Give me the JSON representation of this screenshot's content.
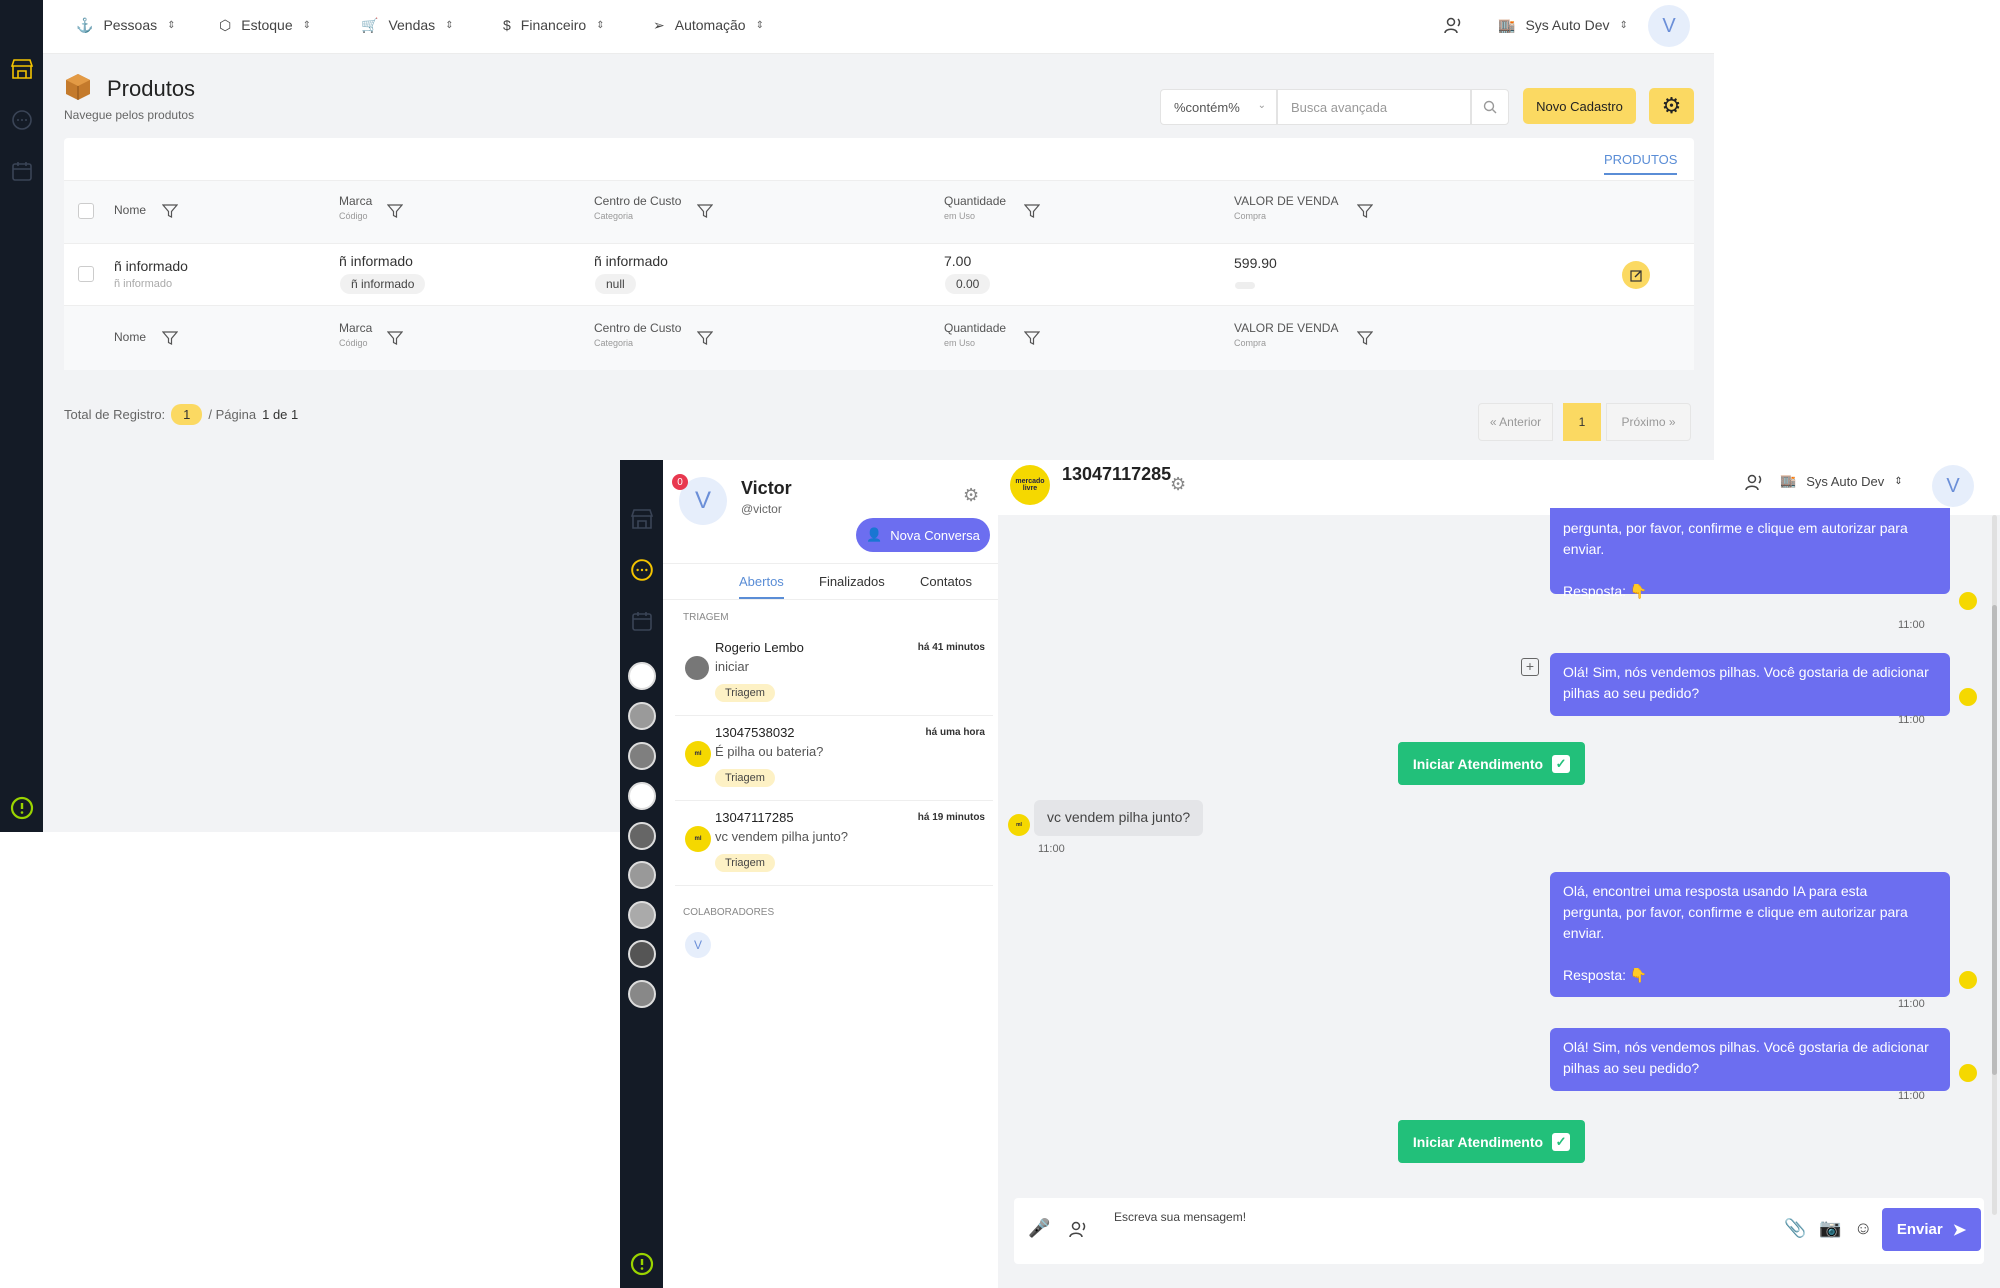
{
  "products_window": {
    "nav": {
      "items": [
        {
          "label": "Pessoas"
        },
        {
          "label": "Estoque"
        },
        {
          "label": "Vendas"
        },
        {
          "label": "Financeiro"
        },
        {
          "label": "Automação"
        }
      ],
      "company": "Sys Auto Dev",
      "avatar_initial": "V"
    },
    "page": {
      "title": "Produtos",
      "subtitle": "Navegue pelos produtos"
    },
    "search": {
      "operator": "%contém%",
      "placeholder": "Busca avançada",
      "new_button": "Novo Cadastro"
    },
    "tab": "PRODUTOS",
    "table": {
      "columns": [
        {
          "label": "Nome",
          "sub": ""
        },
        {
          "label": "Marca",
          "sub": "Código"
        },
        {
          "label": "Centro de Custo",
          "sub": "Categoria"
        },
        {
          "label": "Quantidade",
          "sub": "em Uso"
        },
        {
          "label": "VALOR DE VENDA",
          "sub": "Compra"
        }
      ],
      "rows": [
        {
          "nome": "ñ informado",
          "nome_sub": "ñ informado",
          "marca": "ñ informado",
          "codigo": "ñ informado",
          "centro": "ñ informado",
          "categoria": "null",
          "quantidade": "7.00",
          "em_uso": "0.00",
          "valor": "599.90"
        }
      ]
    },
    "footer": {
      "total_label": "Total de Registro:",
      "total_value": "1",
      "page_label": "/ Página",
      "page_value": "1 de 1",
      "prev": "« Anterior",
      "current": "1",
      "next": "Próximo »"
    }
  },
  "chat_window": {
    "user": {
      "name": "Victor",
      "handle": "@victor",
      "avatar_initial": "V",
      "badge": "0"
    },
    "new_chat_button": "Nova Conversa",
    "tabs": [
      "Abertos",
      "Finalizados",
      "Contatos"
    ],
    "section_triagem": "TRIAGEM",
    "conversations": [
      {
        "name": "Rogerio Lembo",
        "message": "iniciar",
        "time": "há 41 minutos",
        "tag": "Triagem"
      },
      {
        "name": "13047538032",
        "message": "É pilha ou bateria?",
        "time": "há uma hora",
        "tag": "Triagem"
      },
      {
        "name": "13047117285",
        "message": "vc vendem pilha junto?",
        "time": "há 19 minutos",
        "tag": "Triagem"
      }
    ],
    "section_colaboradores": "COLABORADORES",
    "collaborator_initial": "V",
    "header": {
      "contact": "13047117285",
      "logo_text": "mercado livre",
      "company": "Sys Auto Dev",
      "avatar_initial": "V"
    },
    "messages": [
      {
        "type": "out",
        "text_lines": [
          "pergunta, por favor, confirme e clique em autorizar para",
          "enviar.",
          "",
          "Resposta: 👇"
        ],
        "time": "11:00"
      },
      {
        "type": "out",
        "text_lines": [
          "Olá! Sim, nós vendemos pilhas. Você gostaria de adicionar",
          "pilhas ao seu pedido?"
        ],
        "time": "11:00"
      },
      {
        "type": "action",
        "label": "Iniciar Atendimento"
      },
      {
        "type": "in",
        "text_lines": [
          "vc vendem pilha junto?"
        ],
        "time": "11:00"
      },
      {
        "type": "out",
        "text_lines": [
          "Olá, encontrei uma resposta usando IA para esta",
          "pergunta, por favor, confirme e clique em autorizar para",
          "enviar.",
          "",
          "Resposta: 👇"
        ],
        "time": "11:00"
      },
      {
        "type": "out",
        "text_lines": [
          "Olá! Sim, nós vendemos pilhas. Você gostaria de adicionar",
          "pilhas ao seu pedido?"
        ],
        "time": "11:00"
      },
      {
        "type": "action",
        "label": "Iniciar Atendimento"
      }
    ],
    "composer": {
      "placeholder": "Escreva sua mensagem!",
      "send_label": "Enviar"
    }
  }
}
